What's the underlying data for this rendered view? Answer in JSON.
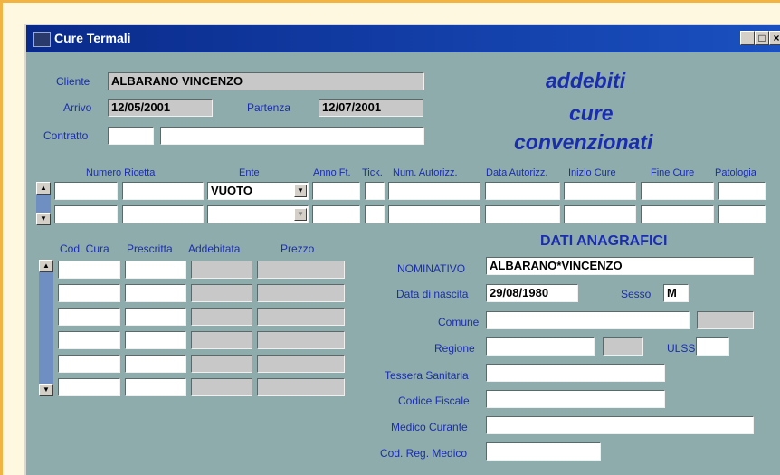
{
  "window": {
    "title": "Cure Termali",
    "minimize": "_",
    "maximize": "□",
    "close": "×"
  },
  "header": {
    "cliente_label": "Cliente",
    "cliente_value": "ALBARANO VINCENZO",
    "arrivo_label": "Arrivo",
    "arrivo_value": "12/05/2001",
    "partenza_label": "Partenza",
    "partenza_value": "12/07/2001",
    "contratto_label": "Contratto",
    "contratto_code": "",
    "contratto_desc": ""
  },
  "banner": {
    "line1": "addebiti",
    "line2": "cure",
    "line3": "convenzionati"
  },
  "ricette": {
    "columns": [
      "Numero Ricetta",
      "Ente",
      "Anno Ft.",
      "Tick.",
      "Num. Autorizz.",
      "Data Autorizz.",
      "Inizio Cure",
      "Fine Cure",
      "Patologia"
    ],
    "rows": [
      {
        "ente": "VUOTO"
      },
      {
        "ente": ""
      }
    ]
  },
  "cure": {
    "columns": [
      "Cod. Cura",
      "Prescritta",
      "Addebitata",
      "Prezzo"
    ],
    "row_count": 6
  },
  "anagrafici": {
    "title": "DATI ANAGRAFICI",
    "nominativo_label": "NOMINATIVO",
    "nominativo_value": "ALBARANO*VINCENZO",
    "nascita_label": "Data di nascita",
    "nascita_value": "29/08/1980",
    "sesso_label": "Sesso",
    "sesso_value": "M",
    "comune_label": "Comune",
    "regione_label": "Regione",
    "ulss_label": "ULSS",
    "tessera_label": "Tessera Sanitaria",
    "cf_label": "Codice Fiscale",
    "medico_label": "Medico Curante",
    "codreg_label": "Cod. Reg. Medico"
  },
  "colors": {
    "panel": "#8eacac",
    "label": "#1a2db0",
    "titlebar": "#0a2a8a",
    "scrollbar": "#6f8fc3"
  }
}
